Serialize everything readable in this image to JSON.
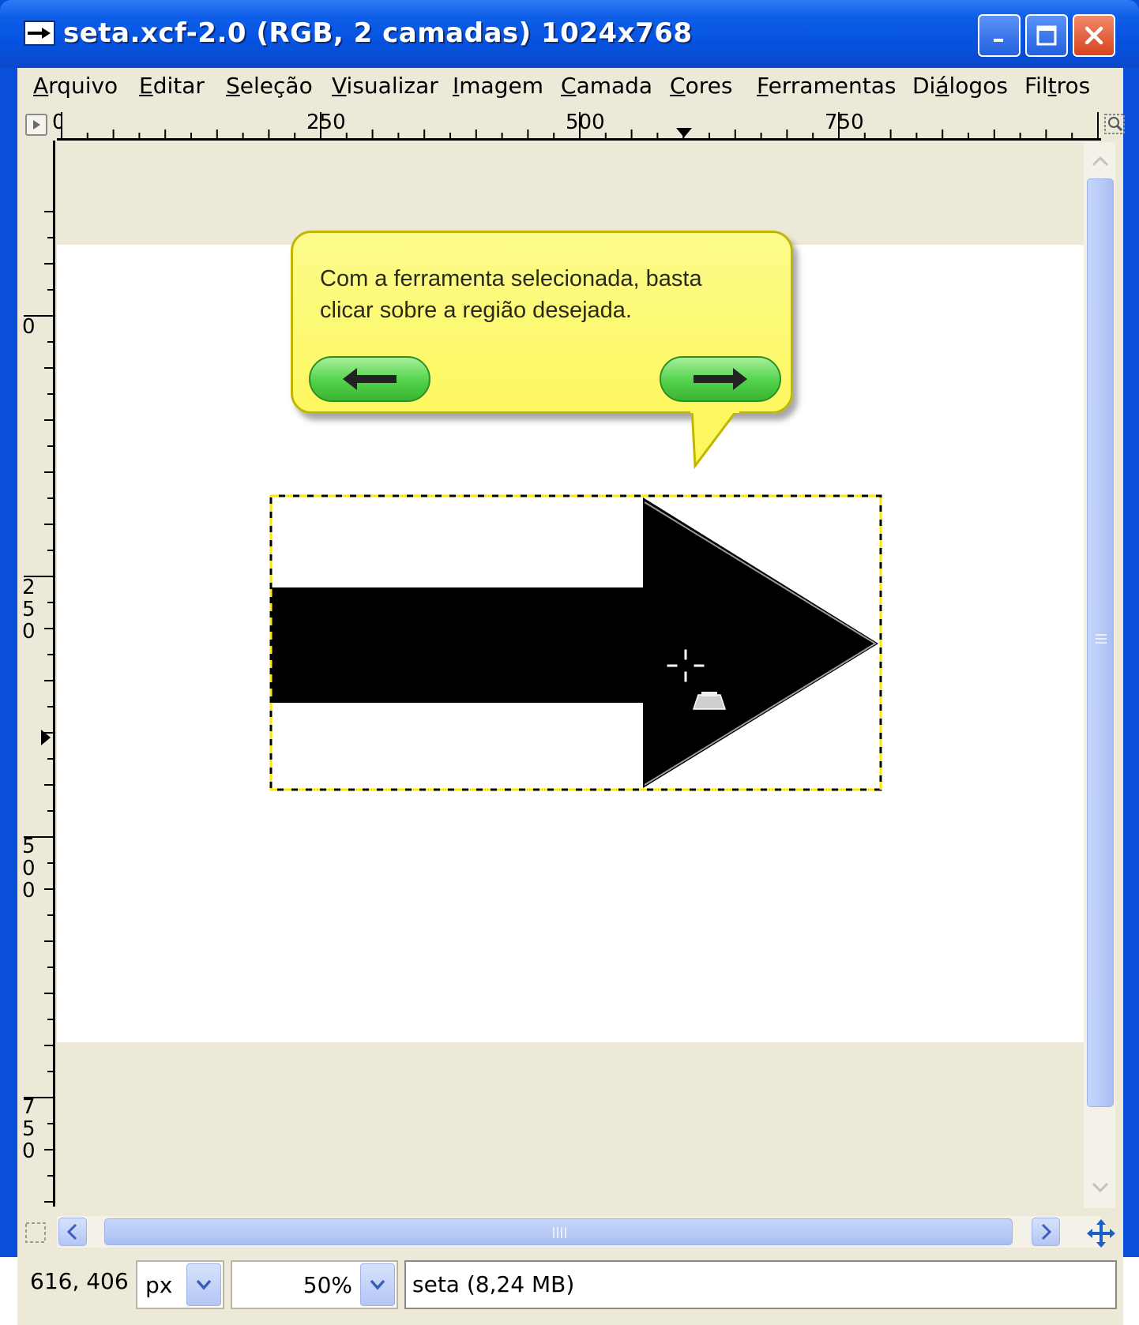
{
  "window": {
    "title": "seta.xcf-2.0 (RGB, 2 camadas) 1024x768"
  },
  "menu": {
    "items": [
      {
        "label": "Arquivo",
        "u": "A",
        "rest": "rquivo"
      },
      {
        "label": "Editar",
        "u": "E",
        "rest": "ditar"
      },
      {
        "label": "Seleção",
        "u": "S",
        "rest": "eleção"
      },
      {
        "label": "Visualizar",
        "u": "V",
        "rest": "isualizar"
      },
      {
        "label": "Imagem",
        "u": "I",
        "rest": "magem"
      },
      {
        "label": "Camada",
        "u": "C",
        "rest": "amada"
      },
      {
        "label": "Cores",
        "u": "C",
        "rest": "ores"
      },
      {
        "label": "Ferramentas",
        "u": "F",
        "rest": "erramentas"
      },
      {
        "label": "Diálogos",
        "pre": "Di",
        "u": "á",
        "rest": "logos"
      },
      {
        "label": "Filtros",
        "pre": "Fil",
        "u": "t",
        "rest": "ros"
      }
    ]
  },
  "rulers": {
    "horizontal_labels": [
      "0",
      "250",
      "500",
      "750"
    ],
    "vertical_labels": [
      "0",
      "250",
      "500",
      "750"
    ]
  },
  "canvas": {
    "tooltip_text": "Com a ferramenta selecionada, basta clicar sobre a região desejada.",
    "tooltip_line1": "Com a ferramenta selecionada, basta",
    "tooltip_line2": "clicar sobre a região desejada."
  },
  "status": {
    "coords": "616, 406",
    "unit": "px",
    "zoom": "50%",
    "info": "seta (8,24 MB)"
  },
  "colors": {
    "titlebar": "#0553e0",
    "balloon": "#fdf860",
    "nav_button": "#52d24a",
    "selection_dash": "#ffe800"
  }
}
